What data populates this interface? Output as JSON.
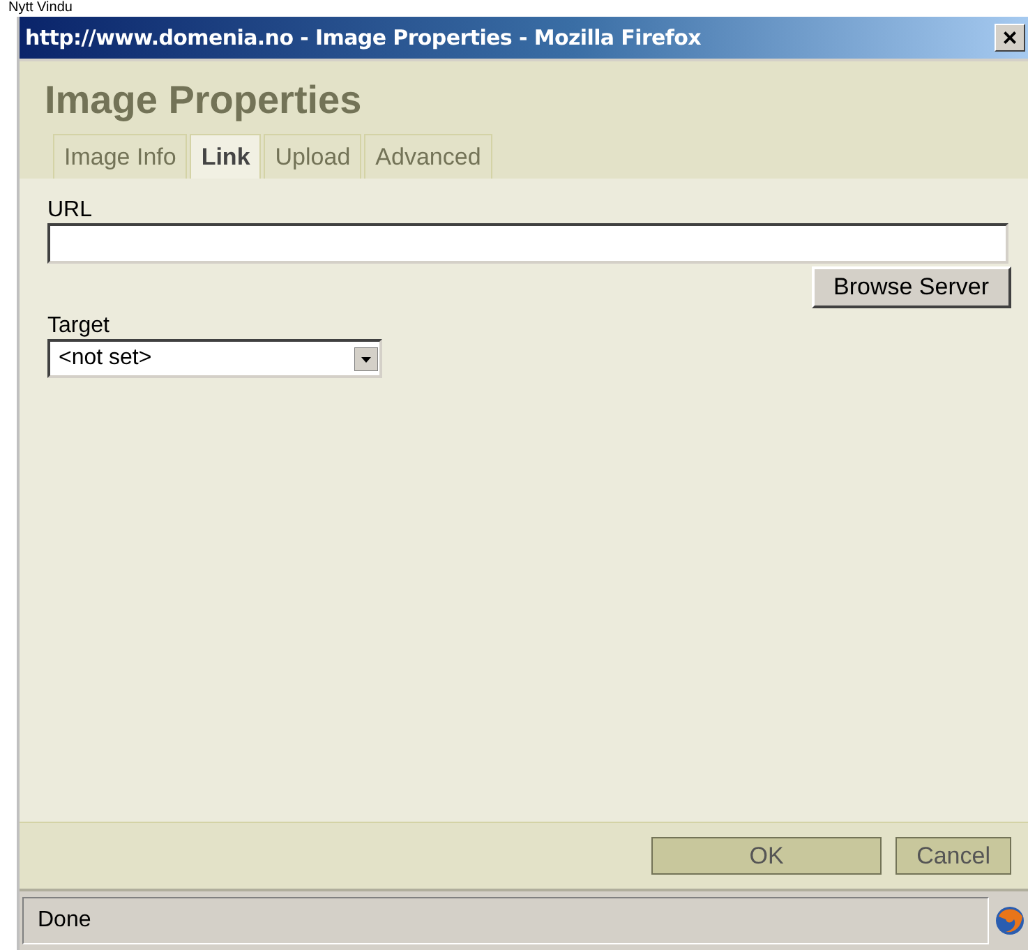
{
  "background_text": "Nytt Vindu",
  "window": {
    "title": "http://www.domenia.no - Image Properties - Mozilla Firefox",
    "close": "×"
  },
  "dialog": {
    "title": "Image Properties"
  },
  "tabs": [
    {
      "label": "Image Info",
      "selected": false
    },
    {
      "label": "Link",
      "selected": true
    },
    {
      "label": "Upload",
      "selected": false
    },
    {
      "label": "Advanced",
      "selected": false
    }
  ],
  "url": {
    "label": "URL"
  },
  "browse_button": "Browse Server",
  "target": {
    "label": "Target",
    "value": "<not set>"
  },
  "buttons": [
    {
      "label": "OK",
      "kind": "primary"
    },
    {
      "label": "Cancel",
      "kind": "secondary"
    }
  ],
  "status_bar": {
    "text": "Done"
  }
}
